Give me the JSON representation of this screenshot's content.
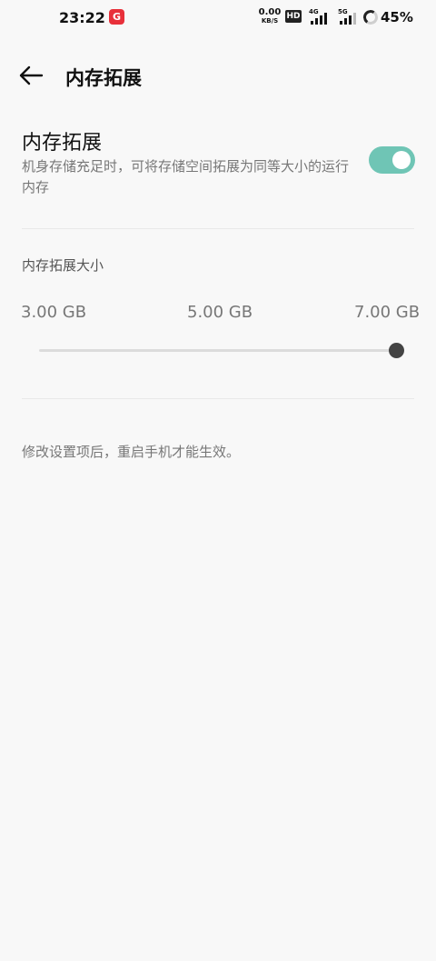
{
  "status_bar": {
    "time": "23:22",
    "app_badge": "G",
    "net_speed_value": "0.00",
    "net_speed_unit": "KB/S",
    "hd_label": "HD",
    "signal_1_label": "4G",
    "signal_2_label": "5G",
    "battery_percent": "45%"
  },
  "header": {
    "back_icon": "arrow-left-icon",
    "title": "内存拓展"
  },
  "memory_extension": {
    "title": "内存拓展",
    "description": "机身存储充足时，可将存储空间拓展为同等大小的运行内存",
    "enabled": true,
    "toggle_color": "#6fc5b5"
  },
  "size_section": {
    "title": "内存拓展大小",
    "options": [
      "3.00 GB",
      "5.00 GB",
      "7.00 GB"
    ],
    "selected_option": "7.00 GB"
  },
  "note": "修改设置项后，重启手机才能生效。"
}
